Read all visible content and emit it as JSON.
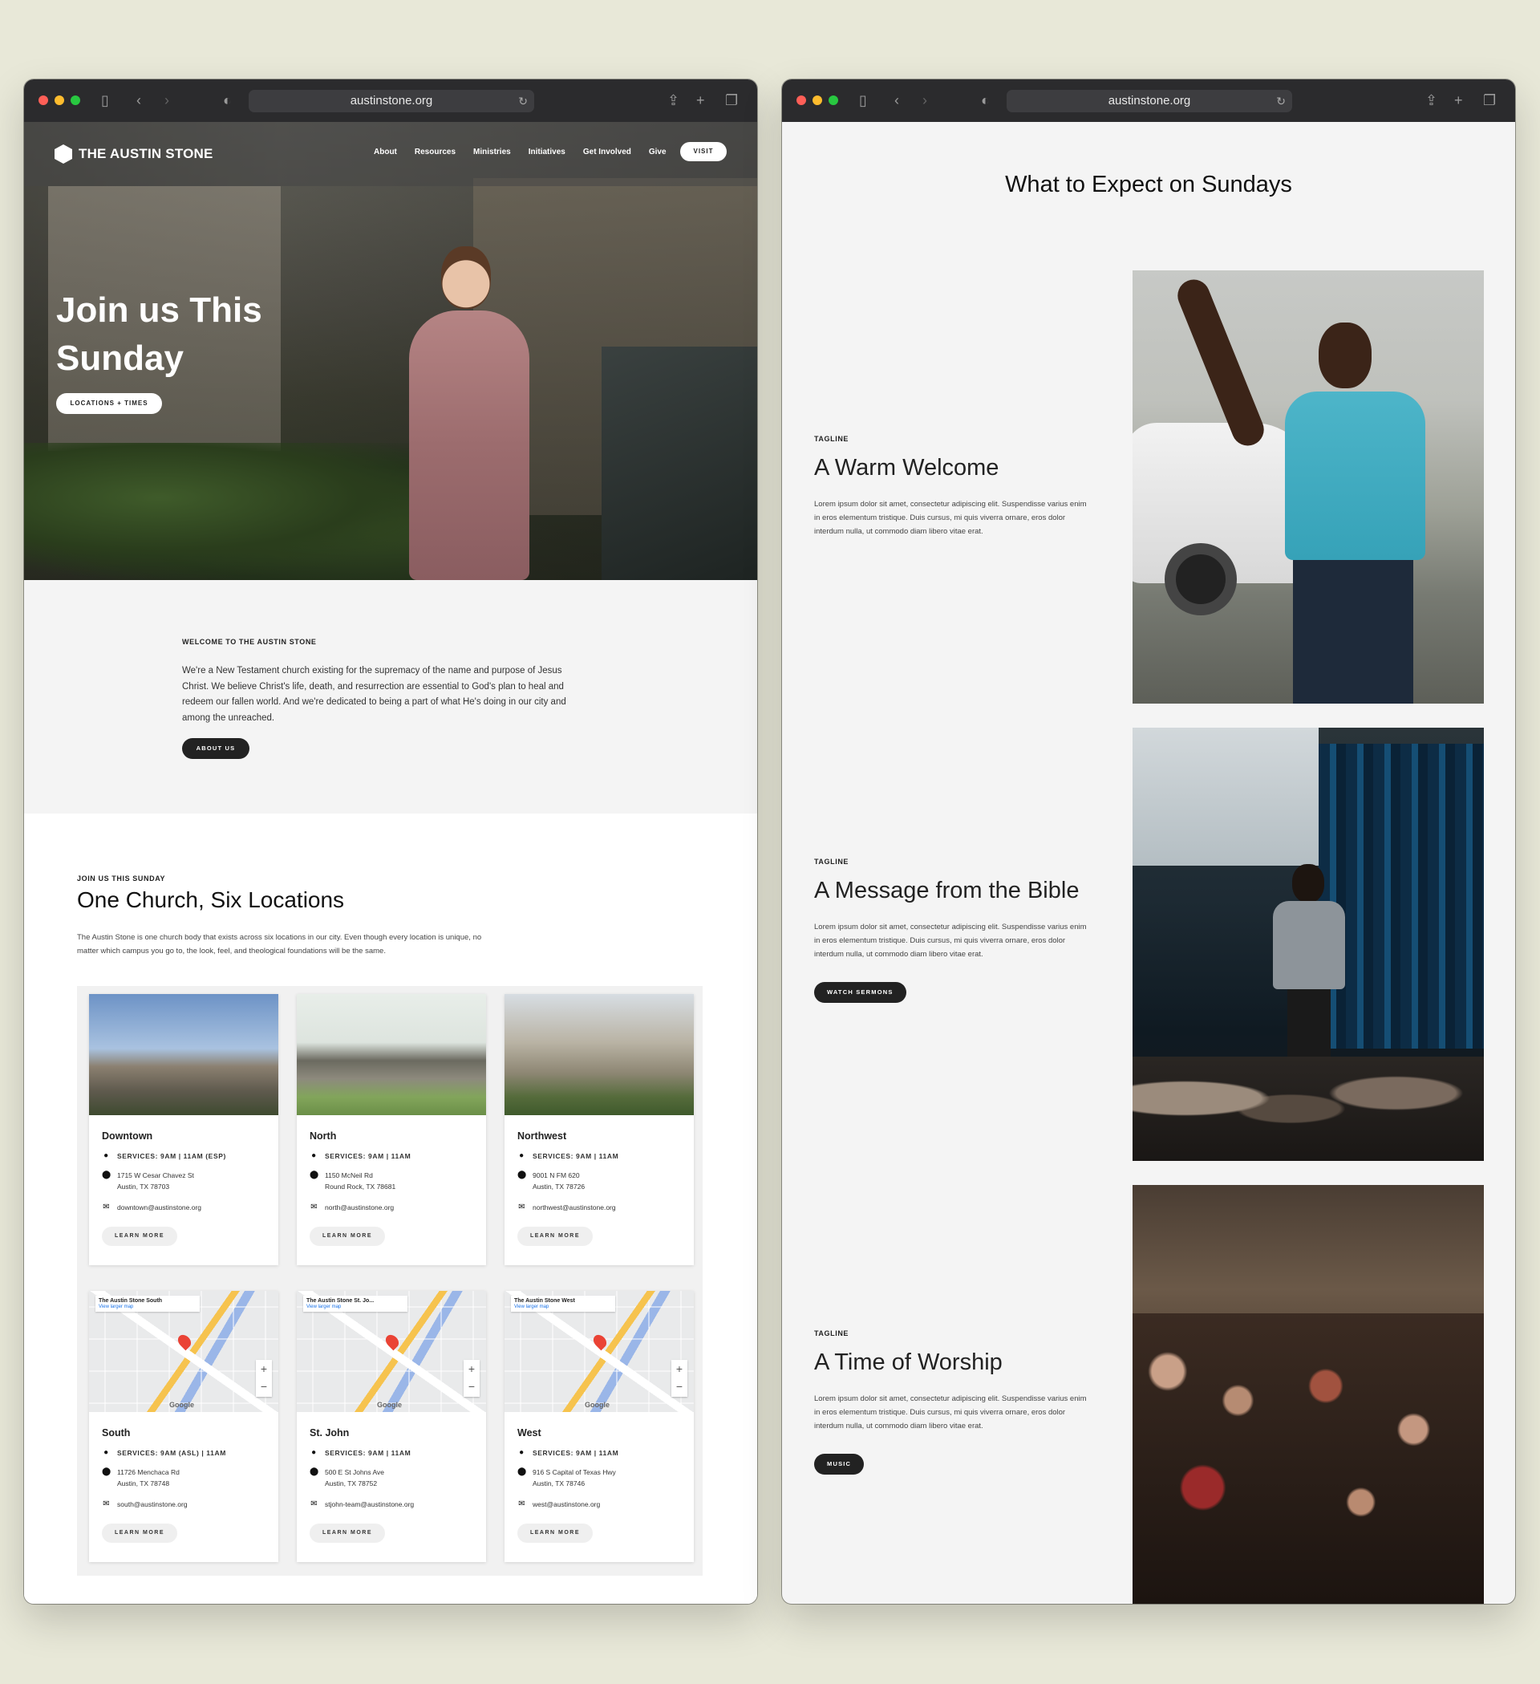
{
  "left_window": {
    "url": "austinstone.org",
    "nav": {
      "logo": "THE AUSTIN STONE",
      "links": [
        "About",
        "Resources",
        "Ministries",
        "Initiatives",
        "Get Involved",
        "Give"
      ],
      "visit": "VISIT"
    },
    "hero": {
      "title": "Join us This Sunday",
      "button": "LOCATIONS + TIMES"
    },
    "welcome": {
      "eyebrow": "WELCOME TO THE AUSTIN STONE",
      "text": "We're a New Testament church existing for the supremacy of the name and purpose of Jesus Christ. We believe Christ's life, death, and resurrection are essential to God's plan to heal and redeem our fallen world. And we're dedicated to being a part of what He's doing in our city and among the unreached.",
      "button": "ABOUT US"
    },
    "locations": {
      "eyebrow": "JOIN US THIS SUNDAY",
      "title": "One Church, Six Locations",
      "description": "The Austin Stone is one church body that exists across six locations in our city. Even though every location is unique, no matter which campus you go to, the look, feel, and theological foundations will be the same.",
      "cards": [
        {
          "name": "Downtown",
          "services": "SERVICES: 9AM | 11AM (ESP)",
          "address1": "1715 W Cesar Chavez St",
          "address2": "Austin, TX 78703",
          "email": "downtown@austinstone.org",
          "button": "LEARN MORE"
        },
        {
          "name": "North",
          "services": "SERVICES: 9AM | 11AM",
          "address1": "1150 McNeil Rd",
          "address2": "Round Rock, TX 78681",
          "email": "north@austinstone.org",
          "button": "LEARN MORE"
        },
        {
          "name": "Northwest",
          "services": "SERVICES: 9AM | 11AM",
          "address1": "9001 N FM 620",
          "address2": "Austin, TX 78726",
          "email": "northwest@austinstone.org",
          "button": "LEARN MORE"
        },
        {
          "name": "South",
          "services": "SERVICES: 9AM (ASL) | 11AM",
          "address1": "11726 Menchaca Rd",
          "address2": "Austin, TX 78748",
          "email": "south@austinstone.org",
          "button": "LEARN MORE",
          "map_label": "The Austin Stone South",
          "map_link": "View larger map"
        },
        {
          "name": "St. John",
          "services": "SERVICES: 9AM | 11AM",
          "address1": "500 E St Johns Ave",
          "address2": "Austin, TX 78752",
          "email": "stjohn-team@austinstone.org",
          "button": "LEARN MORE",
          "map_label": "The Austin Stone St. Jo...",
          "map_link": "View larger map"
        },
        {
          "name": "West",
          "services": "SERVICES: 9AM | 11AM",
          "address1": "916 S Capital of Texas Hwy",
          "address2": "Austin, TX 78746",
          "email": "west@austinstone.org",
          "button": "LEARN MORE",
          "map_label": "The Austin Stone West",
          "map_link": "View larger map"
        }
      ],
      "map_brand": "Google"
    }
  },
  "right_window": {
    "url": "austinstone.org",
    "title": "What to Expect on Sundays",
    "features": [
      {
        "eyebrow": "TAGLINE",
        "heading": "A Warm Welcome",
        "text": "Lorem ipsum dolor sit amet, consectetur adipiscing elit. Suspendisse varius enim in eros elementum tristique. Duis cursus, mi quis viverra ornare, eros dolor interdum nulla, ut commodo diam libero vitae erat.",
        "button": ""
      },
      {
        "eyebrow": "TAGLINE",
        "heading": "A Message from the Bible",
        "text": "Lorem ipsum dolor sit amet, consectetur adipiscing elit. Suspendisse varius enim in eros elementum tristique. Duis cursus, mi quis viverra ornare, eros dolor interdum nulla, ut commodo diam libero vitae erat.",
        "button": "WATCH SERMONS"
      },
      {
        "eyebrow": "TAGLINE",
        "heading": "A Time of Worship",
        "text": "Lorem ipsum dolor sit amet, consectetur adipiscing elit. Suspendisse varius enim in eros elementum tristique. Duis cursus, mi quis viverra ornare, eros dolor interdum nulla, ut commodo diam libero vitae erat.",
        "button": "MUSIC"
      }
    ]
  },
  "colors": {
    "background": "#e8e8d8",
    "chrome": "#2b2b2d",
    "dark_button": "#222222",
    "section_gray": "#f4f4f4"
  }
}
